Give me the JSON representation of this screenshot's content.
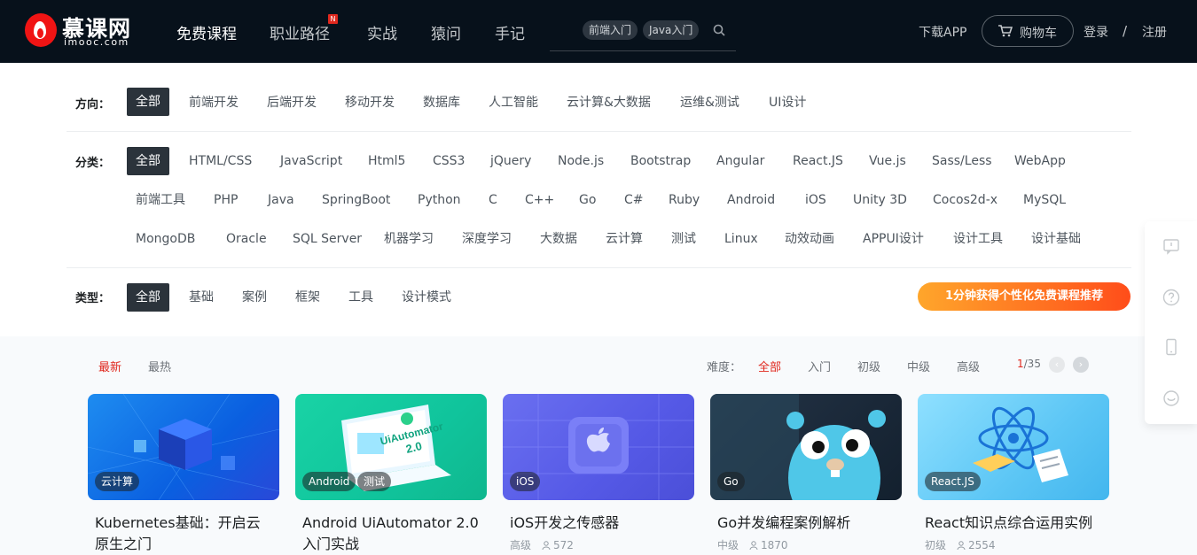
{
  "header": {
    "logo_cn": "慕课网",
    "logo_en": "imooc.com",
    "nav": [
      "免费课程",
      "职业路径",
      "实战",
      "猿问",
      "手记"
    ],
    "nav_badge": "N",
    "search_chips": [
      "前端入门",
      "Java入门"
    ],
    "download": "下载APP",
    "cart": "购物车",
    "login": "登录",
    "slash": "/",
    "register": "注册"
  },
  "filters": {
    "direction": {
      "label": "方向：",
      "tags": [
        "全部",
        "前端开发",
        "后端开发",
        "移动开发",
        "数据库",
        "人工智能",
        "云计算&大数据",
        "运维&测试",
        "UI设计"
      ]
    },
    "category": {
      "label": "分类：",
      "row1": [
        "全部",
        "HTML/CSS",
        "JavaScript",
        "Html5",
        "CSS3",
        "jQuery",
        "Node.js",
        "Bootstrap",
        "Angular",
        "React.JS",
        "Vue.js",
        "Sass/Less",
        "WebApp"
      ],
      "row2": [
        "前端工具",
        "PHP",
        "Java",
        "SpringBoot",
        "Python",
        "C",
        "C++",
        "Go",
        "C#",
        "Ruby",
        "Android",
        "iOS",
        "Unity 3D",
        "Cocos2d-x",
        "MySQL"
      ],
      "row3": [
        "MongoDB",
        "Oracle",
        "SQL Server",
        "机器学习",
        "深度学习",
        "大数据",
        "云计算",
        "测试",
        "Linux",
        "动效动画",
        "APPUI设计",
        "设计工具",
        "设计基础"
      ]
    },
    "type": {
      "label": "类型：",
      "tags": [
        "全部",
        "基础",
        "案例",
        "框架",
        "工具",
        "设计模式"
      ]
    },
    "promo": "1分钟获得个性化免费课程推荐"
  },
  "listing": {
    "sort": [
      "最新",
      "最热"
    ],
    "difficulty_label": "难度：",
    "difficulty": [
      "全部",
      "入门",
      "初级",
      "中级",
      "高级"
    ],
    "pager_current": "1",
    "pager_total": "/35",
    "prev": "‹",
    "next": "›"
  },
  "courses": [
    {
      "label": "云计算",
      "title": "Kubernetes基础：开启云原生之门",
      "level": "",
      "students": ""
    },
    {
      "label": "Android",
      "label2": "测试",
      "title": "Android UiAutomator 2.0 入门实战",
      "level": "",
      "students": ""
    },
    {
      "label": "iOS",
      "title": "iOS开发之传感器",
      "level": "高级",
      "students": "572"
    },
    {
      "label": "Go",
      "title": "Go并发编程案例解析",
      "level": "中级",
      "students": "1870"
    },
    {
      "label": "React.JS",
      "title": "React知识点综合运用实例",
      "level": "初级",
      "students": "2554"
    }
  ],
  "thumb_art": {
    "uiautomator_line1": "UiAutomator",
    "uiautomator_line2": "2.0"
  },
  "colors": {
    "header_bg": "#07111b",
    "accent": "#e0281e",
    "active_tag": "#2b333b",
    "promo_from": "#ffa62b",
    "promo_to": "#ff4d1a"
  }
}
